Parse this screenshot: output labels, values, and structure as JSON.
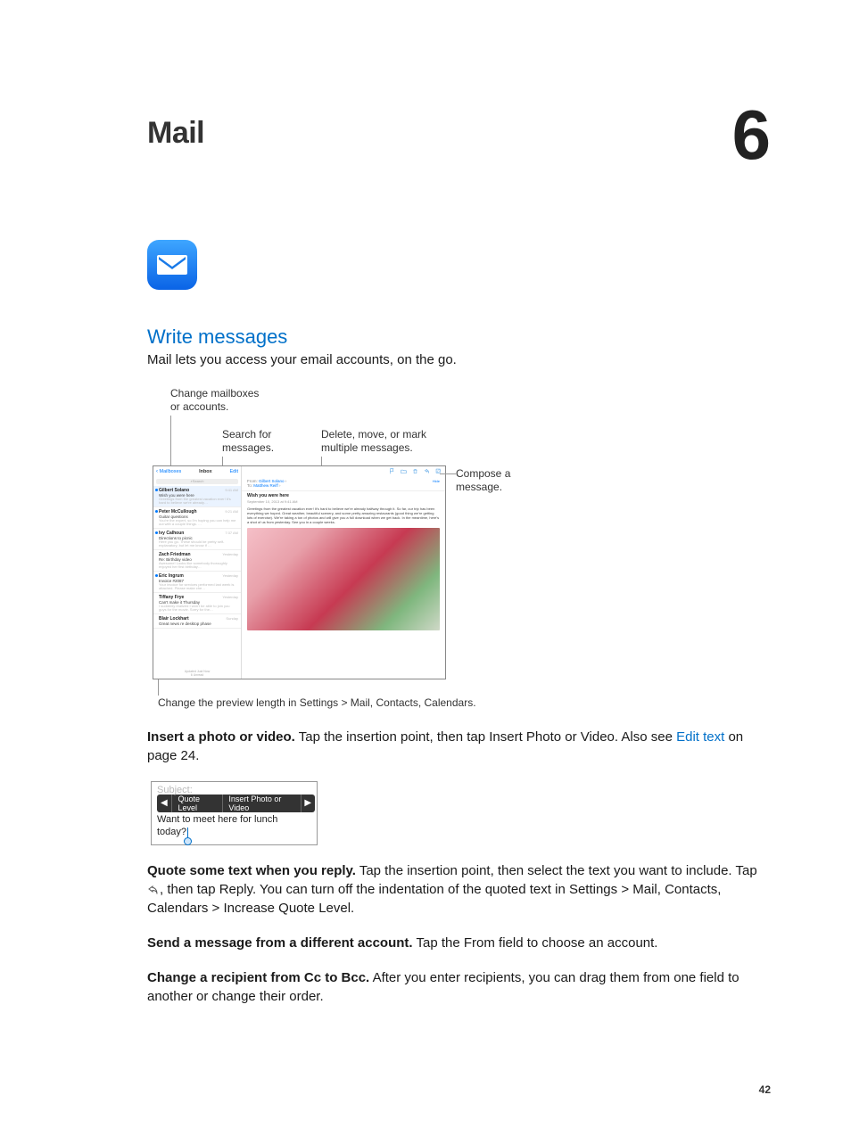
{
  "chapter": {
    "title": "Mail",
    "number": "6"
  },
  "section": {
    "heading": "Write messages",
    "lead": "Mail lets you access your email accounts, on the go."
  },
  "figure1": {
    "callouts": {
      "changeMailboxes": "Change mailboxes or accounts.",
      "searchFor": "Search for messages.",
      "deleteMove": "Delete, move, or mark multiple messages.",
      "compose": "Compose a message.",
      "previewLength": "Change the preview length in Settings > Mail, Contacts, Calendars."
    },
    "toolbarLeft": {
      "back": "Mailboxes",
      "title": "Inbox",
      "edit": "Edit"
    },
    "search": "Search",
    "messages": [
      {
        "sender": "Gilbert Solano",
        "time": "9:41 AM",
        "subject": "Wish you were here",
        "preview": "Greetings from the greatest vacation ever! It's hard to believe we're already…",
        "dot": true,
        "selected": true
      },
      {
        "sender": "Peter McCullough",
        "time": "9:21 AM",
        "subject": "Guitar questions",
        "preview": "You're the expert, so I'm hoping you can help me out with a couple things. …",
        "dot": true
      },
      {
        "sender": "Ivy Calhoun",
        "time": "7:37 AM",
        "subject": "Directions to picnic",
        "preview": "Here you go. These should be pretty self-explanatory, but let me know if …",
        "dot": true
      },
      {
        "sender": "Zach Friedman",
        "time": "Yesterday",
        "subject": "Re: Birthday video",
        "preview": "Awesome! Looks like somebody thoroughly enjoyed her first birthday…",
        "dot": false
      },
      {
        "sender": "Eric Ingrum",
        "time": "Yesterday",
        "subject": "Invoice #2087",
        "preview": "Your invoice for services performed last week is attached. Please make che…",
        "dot": true
      },
      {
        "sender": "Tiffany Frye",
        "time": "Yesterday",
        "subject": "Can't make it Thursday",
        "preview": "I suddenly realized I won't be able to join you guys for the movie. Sorry for the…",
        "dot": false
      },
      {
        "sender": "Blair Lockhart",
        "time": "Sunday",
        "subject": "Great news re desktop phase",
        "preview": "",
        "dot": false
      }
    ],
    "updatedLine1": "Updated Just Now",
    "updatedLine2": "6 Unread",
    "msg": {
      "fromLabel": "From:",
      "fromName": "Gilbert Solano",
      "toLabel": "To:",
      "toName": "Matthew Reiff",
      "hide": "Hide",
      "subject": "Wish you were here",
      "date": "September 10, 2013 at 9:41 AM",
      "body": "Greetings from the greatest vacation ever! It's hard to believe we're already halfway through it. So far, our trip has been everything we hoped. Great weather, beautiful scenery, and some pretty amazing restaurants (good thing we're getting lots of exercise). We're taking a ton of photos and will give you a full download when we get back. In the meantime, here's a shot of us from yesterday. See you in a couple weeks."
    }
  },
  "paragraphs": {
    "p1_strong": "Insert a photo or video.",
    "p1_rest": " Tap the insertion point, then tap Insert Photo or Video. Also see ",
    "p1_link": "Edit text",
    "p1_tail": " on page 24.",
    "p2_strong": "Quote some text when you reply.",
    "p2_a": " Tap the insertion point, then select the text you want to include. Tap ",
    "p2_b": ", then tap Reply. You can turn off the indentation of the quoted text in Settings > Mail, Contacts, Calendars > Increase Quote Level.",
    "p3_strong": "Send a message from a different account.",
    "p3_rest": " Tap the From field to choose an account.",
    "p4_strong": "Change a recipient from Cc to Bcc.",
    "p4_rest": " After you enter recipients, you can drag them from one field to another or change their order."
  },
  "figure2": {
    "subjectLabel": "Subject:",
    "quoteLevel": "Quote Level",
    "insertPhoto": "Insert Photo or Video",
    "line1": "Want to meet here for lunch",
    "line2": "today?"
  },
  "pageNumber": "42"
}
